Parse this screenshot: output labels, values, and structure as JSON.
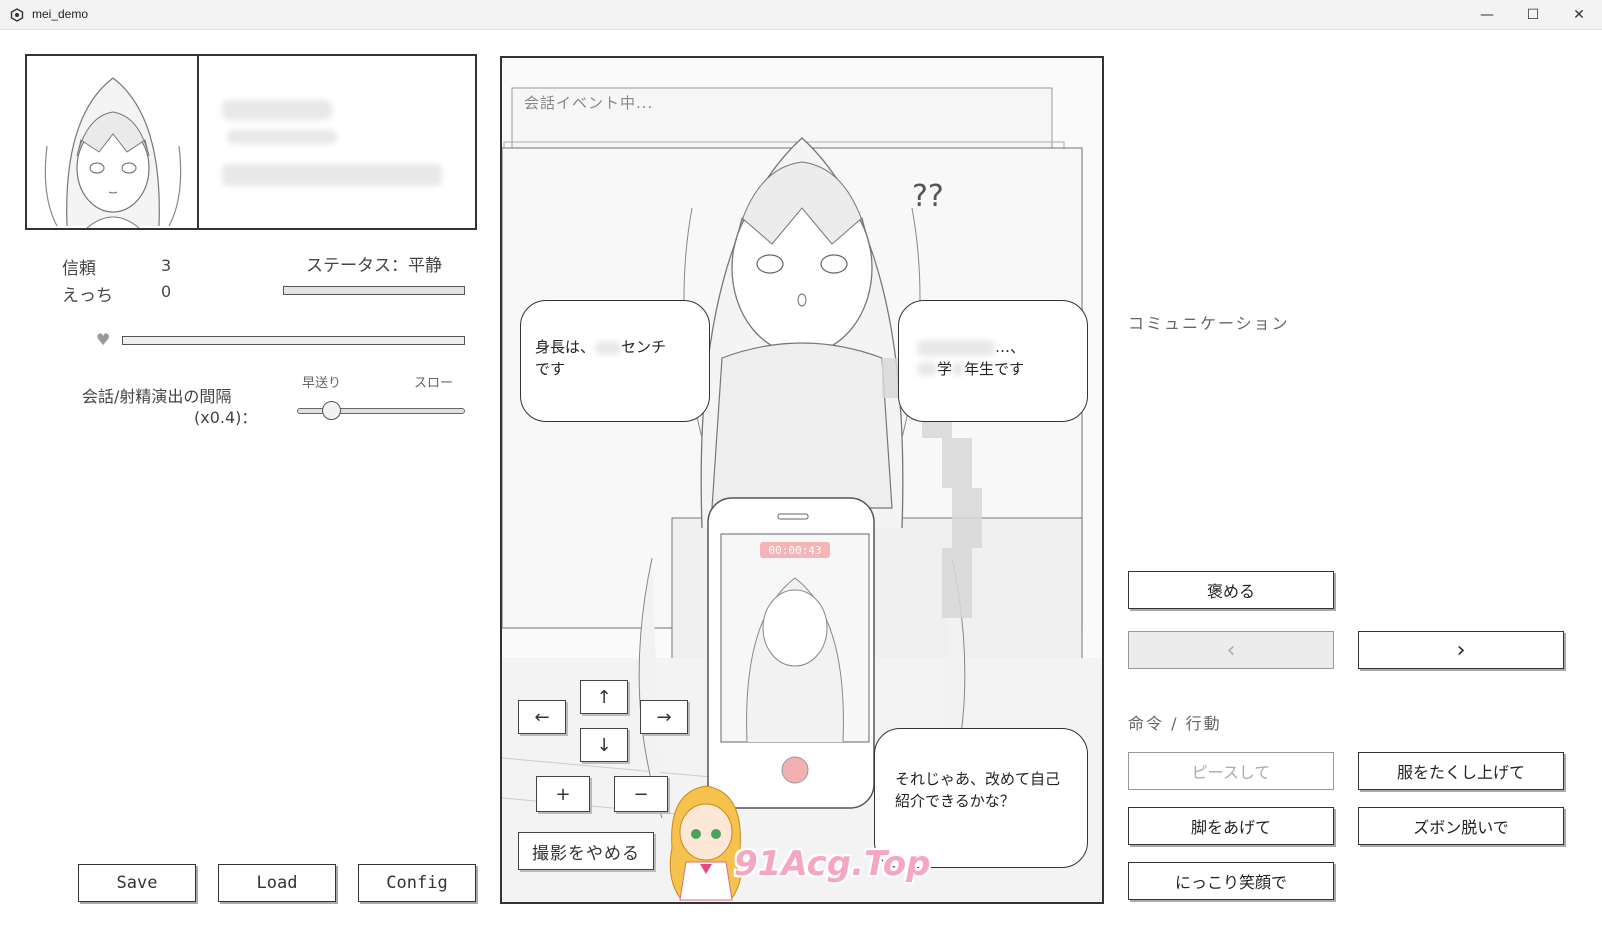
{
  "window": {
    "title": "mei_demo",
    "minimize": "—",
    "maximize": "☐",
    "close": "✕"
  },
  "status_panel": {
    "trust_label": "信頼",
    "trust_value": "3",
    "ecchi_label": "えっち",
    "ecchi_value": "0",
    "status_text": "ステータス：平静",
    "heart": "♥",
    "interval_label_line1": "会話/射精演出の間隔",
    "interval_label_line2": "(x0.4)：",
    "speed_fast": "早送り",
    "speed_slow": "スロー",
    "speed_value": 0.17
  },
  "scene": {
    "event_text": "会話イベント中...",
    "question_marks": "??",
    "bubble_left_line1": "身長は、",
    "bubble_left_unit": "センチ",
    "bubble_left_line2": "です",
    "bubble_right_line1": "…、",
    "bubble_right_line2a": "学",
    "bubble_right_line2b": "年生です",
    "bubble_bottom": "それじゃあ、改めて自己紹介できるかな？",
    "phone_timer": "00:00:43",
    "controls": {
      "up": "↑",
      "down": "↓",
      "left": "←",
      "right": "→",
      "plus": "+",
      "minus": "−"
    },
    "stop_shooting": "撮影をやめる",
    "watermark": "91Acg.Top"
  },
  "right_panel": {
    "communication_label": "コミュニケーション",
    "praise_button": "褒める",
    "prev_button": "‹",
    "next_button": "›",
    "command_label": "命令 / 行動",
    "actions": [
      "ピースして",
      "服をたくし上げて",
      "脚をあげて",
      "ズボン脱いで",
      "にっこり笑顔で"
    ]
  },
  "footer": {
    "save": "Save",
    "load": "Load",
    "config": "Config"
  }
}
